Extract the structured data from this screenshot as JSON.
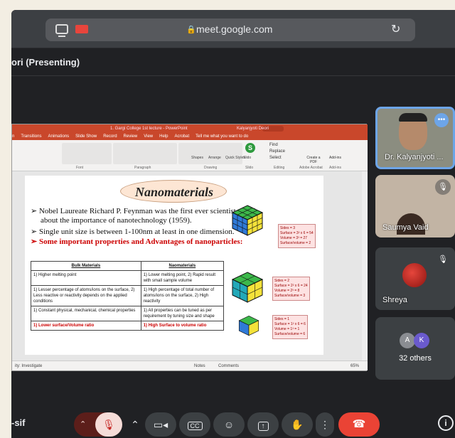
{
  "browser": {
    "url": "meet.google.com",
    "lock_icon": "lock-icon"
  },
  "meeting": {
    "presenter_label": "ori (Presenting)",
    "meeting_code_fragment": "-sif",
    "others_count_label": "32 others"
  },
  "powerpoint": {
    "window_title": "1. Gargi College 1st lecture - PowerPoint",
    "account_name": "Kalyanjyoti Deori",
    "tabs": [
      "n",
      "Transitions",
      "Animations",
      "Slide Show",
      "Record",
      "Review",
      "View",
      "Help",
      "Acrobat",
      "Tell me what you want to do"
    ],
    "ribbon_groups": [
      "Font",
      "Paragraph",
      "Drawing",
      "Slido",
      "Editing",
      "Adobe Acrobat",
      "Add-ins"
    ],
    "ribbon_buttons": {
      "shapes": "Shapes",
      "arrange": "Arrange",
      "quick_styles": "Quick Styles",
      "slido": "Slido",
      "find": "Find",
      "replace": "Replace",
      "select": "Select",
      "create_pdf": "Create a PDF",
      "add_ins": "Add-ins"
    },
    "status_left": "ity: Investigate",
    "status_notes": "Notes",
    "status_comments": "Comments",
    "zoom": "65%"
  },
  "slide": {
    "title": "Nanomaterials",
    "bullets": [
      "➢ Nobel Laureate Richard P. Feynman was the first ever scientist to talk",
      "about the importance of nanotechnology (1959).",
      "➢ Single unit size is between 1-100nm at least in one dimension.",
      "➢ Some important properties and Advantages of nanoparticles:"
    ],
    "table": {
      "headers": [
        "Bulk Materials",
        "Naomaterials"
      ],
      "rows": [
        [
          "1) Higher melting point",
          "1) Lower melting point, 2) Rapid result with small sample volume"
        ],
        [
          "1) Lesser percentage of atoms/ions on the surface, 2) Less reactive or reactivity depends on the applied conditions",
          "1) High percentage of total number of atoms/ions on the surface, 2) High reactivity"
        ],
        [
          "1) Constant physical, mechanical, chemical properties",
          "1) All properties can be tuned as per requirement by tuning size and shape"
        ],
        [
          "1) Lower surface/Volume ratio",
          "1) High Surface to volume ratio"
        ]
      ]
    },
    "notes": [
      "Sides = 3\nSurface = 3² x 6 = 54\nVolume = 3³ = 27\nSurface/volume = 2",
      "Sides = 2\nSurface = 2² x 6 = 24\nVolume = 2³ = 8\nSurface/volume = 3",
      "Sides = 1\nSurface = 1² x 6 = 6\nVolume = 1³ = 1\nSurface/volume = 6"
    ]
  },
  "participants": [
    {
      "name": "Dr. Kalyanjyoti ..."
    },
    {
      "name": "Saumya Vaid"
    },
    {
      "name": "Shreya"
    }
  ],
  "others_avatars": [
    "A",
    "K"
  ],
  "colors": {
    "meet_bg": "#202124",
    "leave": "#ea4335",
    "ppt_accent": "#c9472b",
    "active_speaker": "#6da5e8"
  }
}
